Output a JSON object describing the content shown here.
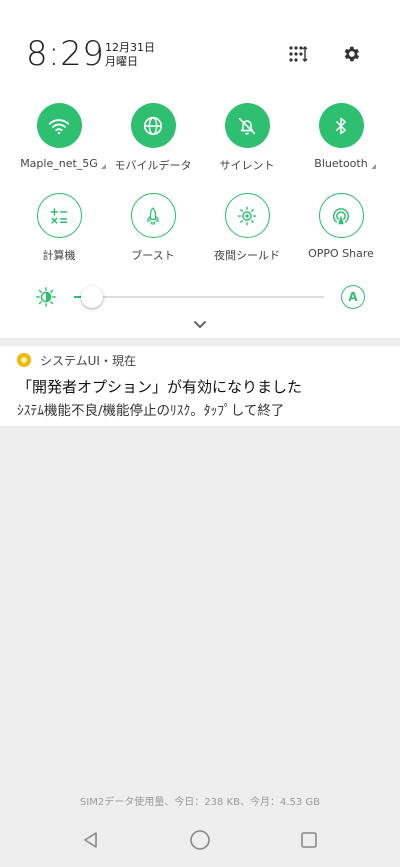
{
  "header": {
    "time": "8:29",
    "date_line1": "12月31日",
    "date_line2": "月曜日"
  },
  "quick_tiles": [
    {
      "label": "Maple_net_5G",
      "icon": "wifi-icon",
      "active": true,
      "has_menu": true
    },
    {
      "label": "モバイルデータ",
      "icon": "globe-icon",
      "active": true,
      "has_menu": false
    },
    {
      "label": "サイレント",
      "icon": "bell-mute-icon",
      "active": true,
      "has_menu": false
    },
    {
      "label": "Bluetooth",
      "icon": "bluetooth-icon",
      "active": true,
      "has_menu": true
    },
    {
      "label": "計算機",
      "icon": "calculator-icon",
      "active": false,
      "has_menu": false
    },
    {
      "label": "ブースト",
      "icon": "rocket-icon",
      "active": false,
      "has_menu": false
    },
    {
      "label": "夜間シールド",
      "icon": "eye-sun-icon",
      "active": false,
      "has_menu": false
    },
    {
      "label": "OPPO Share",
      "icon": "share-target-icon",
      "active": false,
      "has_menu": false
    }
  ],
  "brightness": {
    "level": 0.06,
    "auto_label": "A"
  },
  "notification": {
    "app_name": "システムUI・現在",
    "title": "「開発者オプション」が有効になりました",
    "body": "ｼｽﾃﾑ機能不良/機能停止のﾘｽｸ。ﾀｯﾌﾟして終了"
  },
  "data_usage": "SIM2データ使用量、今日：238 KB、今月：4.53 GB",
  "colors": {
    "accent": "#2fbf71",
    "notification_icon": "#f5b800"
  }
}
